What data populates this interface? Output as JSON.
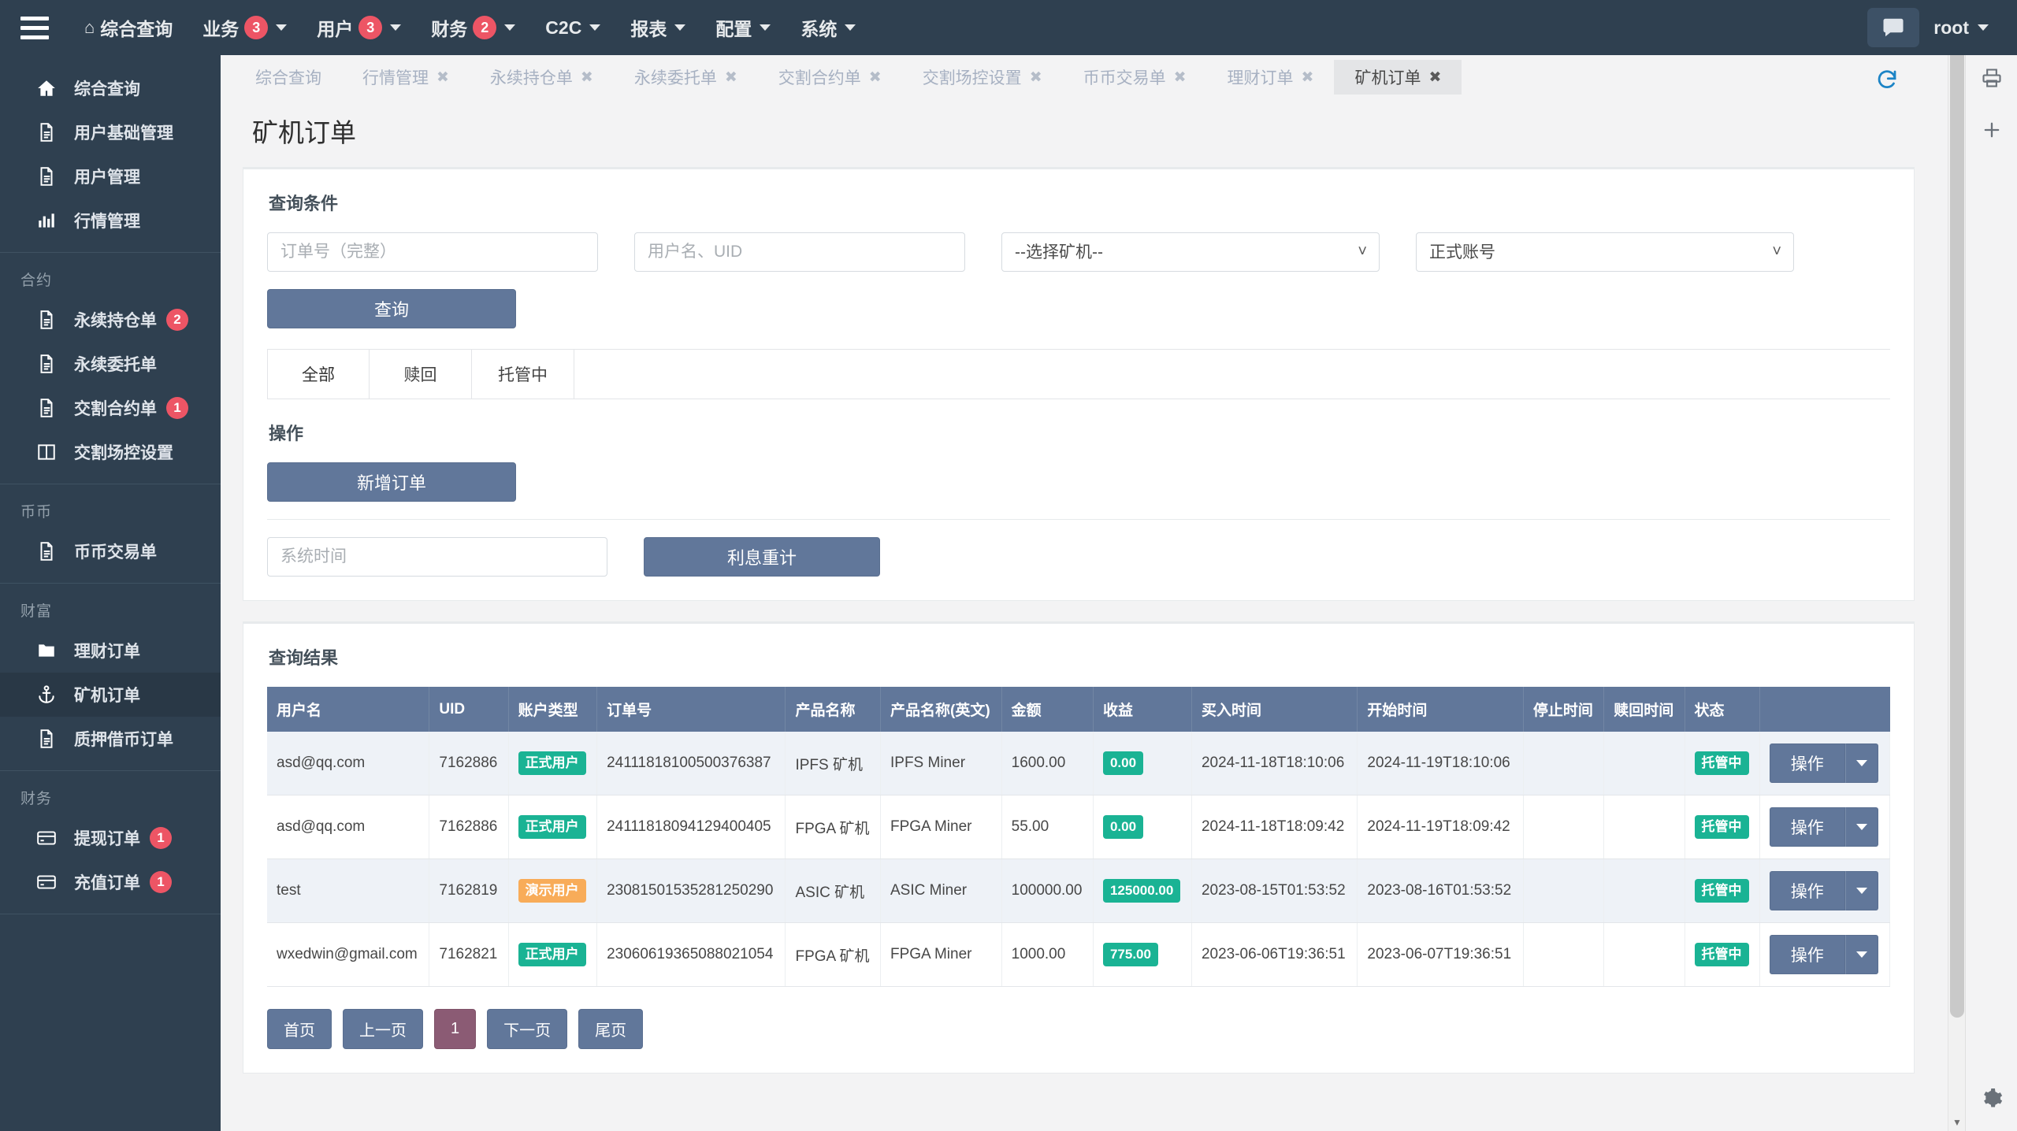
{
  "navbar": {
    "hamburger_name": "menu-toggle",
    "home_label": "综合查询",
    "items": [
      {
        "label": "业务",
        "badge": "3",
        "caret": true
      },
      {
        "label": "用户",
        "badge": "3",
        "caret": true
      },
      {
        "label": "财务",
        "badge": "2",
        "caret": true
      },
      {
        "label": "C2C",
        "badge": "",
        "caret": true
      },
      {
        "label": "报表",
        "badge": "",
        "caret": true
      },
      {
        "label": "配置",
        "badge": "",
        "caret": true
      },
      {
        "label": "系统",
        "badge": "",
        "caret": true
      }
    ],
    "user": "root"
  },
  "sidebar": {
    "groups": [
      {
        "title": "",
        "items": [
          {
            "label": "综合查询",
            "icon": "home-icon",
            "badge": "",
            "active": false
          },
          {
            "label": "用户基础管理",
            "icon": "document-icon",
            "badge": "",
            "active": false
          },
          {
            "label": "用户管理",
            "icon": "document-icon",
            "badge": "",
            "active": false
          },
          {
            "label": "行情管理",
            "icon": "bar-chart-icon",
            "badge": "",
            "active": false
          }
        ]
      },
      {
        "title": "合约",
        "items": [
          {
            "label": "永续持仓单",
            "icon": "document-icon",
            "badge": "2",
            "active": false
          },
          {
            "label": "永续委托单",
            "icon": "document-icon",
            "badge": "",
            "active": false
          },
          {
            "label": "交割合约单",
            "icon": "document-icon",
            "badge": "1",
            "active": false
          },
          {
            "label": "交割场控设置",
            "icon": "columns-icon",
            "badge": "",
            "active": false
          }
        ]
      },
      {
        "title": "币币",
        "items": [
          {
            "label": "币币交易单",
            "icon": "document-icon",
            "badge": "",
            "active": false
          }
        ]
      },
      {
        "title": "财富",
        "items": [
          {
            "label": "理财订单",
            "icon": "folder-icon",
            "badge": "",
            "active": false
          },
          {
            "label": "矿机订单",
            "icon": "anchor-icon",
            "badge": "",
            "active": true
          },
          {
            "label": "质押借币订单",
            "icon": "document-icon",
            "badge": "",
            "active": false
          }
        ]
      },
      {
        "title": "财务",
        "items": [
          {
            "label": "提现订单",
            "icon": "credit-card-icon",
            "badge": "1",
            "active": false
          },
          {
            "label": "充值订单",
            "icon": "credit-card-icon",
            "badge": "1",
            "active": false
          }
        ]
      }
    ]
  },
  "tabs": [
    {
      "label": "综合查询",
      "closable": false,
      "active": false
    },
    {
      "label": "行情管理",
      "closable": true,
      "active": false
    },
    {
      "label": "永续持仓单",
      "closable": true,
      "active": false
    },
    {
      "label": "永续委托单",
      "closable": true,
      "active": false
    },
    {
      "label": "交割合约单",
      "closable": true,
      "active": false
    },
    {
      "label": "交割场控设置",
      "closable": true,
      "active": false
    },
    {
      "label": "币币交易单",
      "closable": true,
      "active": false
    },
    {
      "label": "理财订单",
      "closable": true,
      "active": false
    },
    {
      "label": "矿机订单",
      "closable": true,
      "active": true
    }
  ],
  "page": {
    "title": "矿机订单"
  },
  "query_panel": {
    "heading": "查询条件",
    "order_no_placeholder": "订单号（完整）",
    "order_no_value": "",
    "user_placeholder": "用户名、UID",
    "user_value": "",
    "miner_select_value": "--选择矿机--",
    "miner_select_options": [
      "--选择矿机--"
    ],
    "account_select_value": "正式账号",
    "account_select_options": [
      "正式账号"
    ],
    "search_button": "查询",
    "status_tabs": [
      {
        "label": "全部",
        "active": true
      },
      {
        "label": "赎回",
        "active": false
      },
      {
        "label": "托管中",
        "active": false
      }
    ]
  },
  "operation_panel": {
    "heading": "操作",
    "add_order_button": "新增订单",
    "system_time_placeholder": "系统时间",
    "system_time_value": "",
    "recalc_button": "利息重计"
  },
  "results_panel": {
    "heading": "查询结果",
    "columns": [
      "用户名",
      "UID",
      "账户类型",
      "订单号",
      "产品名称",
      "产品名称(英文)",
      "金额",
      "收益",
      "买入时间",
      "开始时间",
      "停止时间",
      "赎回时间",
      "状态",
      ""
    ],
    "rows": [
      {
        "username": "asd@qq.com",
        "uid": "7162886",
        "account_type": "正式用户",
        "account_type_color": "green",
        "order_no": "24111818100500376387",
        "product_cn": "IPFS 矿机",
        "product_en": "IPFS Miner",
        "amount": "1600.00",
        "profit": "0.00",
        "buy_time": "2024-11-18T18:10:06",
        "start_time": "2024-11-19T18:10:06",
        "stop_time": "",
        "redeem_time": "",
        "status": "托管中",
        "action": "操作"
      },
      {
        "username": "asd@qq.com",
        "uid": "7162886",
        "account_type": "正式用户",
        "account_type_color": "green",
        "order_no": "24111818094129400405",
        "product_cn": "FPGA 矿机",
        "product_en": "FPGA Miner",
        "amount": "55.00",
        "profit": "0.00",
        "buy_time": "2024-11-18T18:09:42",
        "start_time": "2024-11-19T18:09:42",
        "stop_time": "",
        "redeem_time": "",
        "status": "托管中",
        "action": "操作"
      },
      {
        "username": "test",
        "uid": "7162819",
        "account_type": "演示用户",
        "account_type_color": "orange",
        "order_no": "23081501535281250290",
        "product_cn": "ASIC 矿机",
        "product_en": "ASIC Miner",
        "amount": "100000.00",
        "profit": "125000.00",
        "buy_time": "2023-08-15T01:53:52",
        "start_time": "2023-08-16T01:53:52",
        "stop_time": "",
        "redeem_time": "",
        "status": "托管中",
        "action": "操作"
      },
      {
        "username": "wxedwin@gmail.com",
        "uid": "7162821",
        "account_type": "正式用户",
        "account_type_color": "green",
        "order_no": "23060619365088021054",
        "product_cn": "FPGA 矿机",
        "product_en": "FPGA Miner",
        "amount": "1000.00",
        "profit": "775.00",
        "buy_time": "2023-06-06T19:36:51",
        "start_time": "2023-06-07T19:36:51",
        "stop_time": "",
        "redeem_time": "",
        "status": "托管中",
        "action": "操作"
      }
    ],
    "pagination": {
      "first": "首页",
      "prev": "上一页",
      "current": "1",
      "next": "下一页",
      "last": "尾页"
    }
  },
  "colors": {
    "sidebar_bg": "#2f4050",
    "primary_button": "#61779a",
    "table_header": "#61779a",
    "badge_red": "#ed5565",
    "status_green": "#1ab394",
    "status_orange": "#f8ac59",
    "link_blue": "#4b8fd4",
    "current_page": "#8b5b74"
  }
}
